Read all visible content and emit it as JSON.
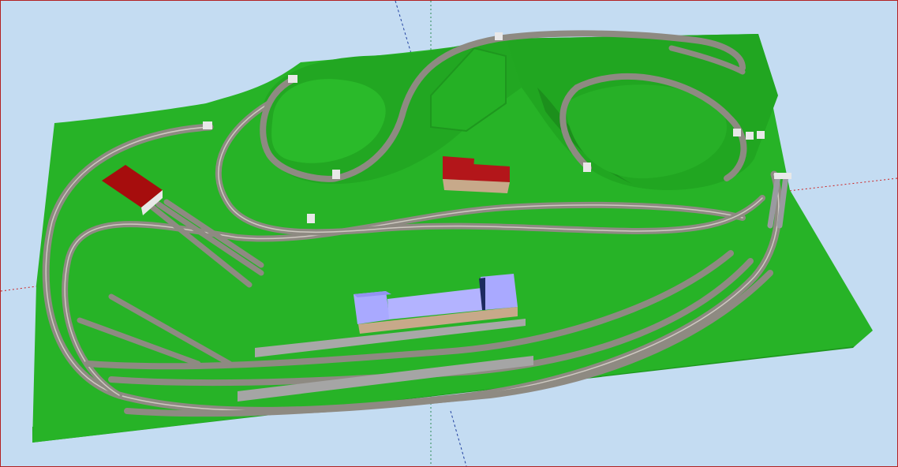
{
  "viewport": {
    "background": "#c4dcf2",
    "frame_color": "#b22222",
    "axis_colors": {
      "red_axis": "#cc2222",
      "green_axis": "#2e8b57",
      "blue_axis": "#1f3f9f"
    }
  },
  "layout_model": {
    "terrain_color": "#27b327",
    "terrain_side_color": "#1f9a1f",
    "track_ballast_color": "#8e8a82",
    "track_rail_color": "#c9c4bc",
    "platform_color": "#a8a8a8",
    "buildings": [
      {
        "kind": "engine-shed",
        "color": "#a60d0d"
      },
      {
        "kind": "station-building",
        "color": "#a9a9ff"
      },
      {
        "kind": "house",
        "color": "#b3161a"
      }
    ],
    "tunnel_portal_color": "#e8e8e8"
  }
}
